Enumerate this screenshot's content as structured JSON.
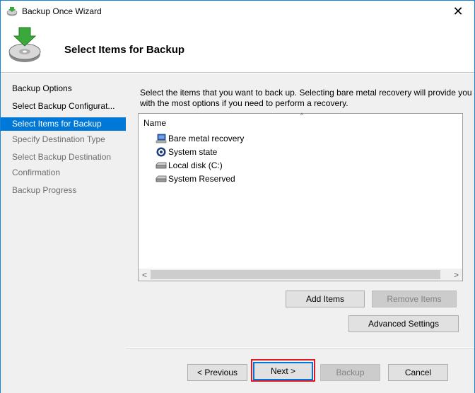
{
  "window": {
    "title": "Backup Once Wizard",
    "close_symbol": "✕",
    "app_icon": "backup-app-icon"
  },
  "header": {
    "title": "Select Items for Backup",
    "icon": "backup-disk-icon"
  },
  "nav": {
    "items": [
      {
        "label": "Backup Options",
        "state": "normal"
      },
      {
        "label": "Select Backup Configurat...",
        "state": "normal"
      },
      {
        "label": "Select Items for Backup",
        "state": "selected"
      },
      {
        "label": "Specify Destination Type",
        "state": "dim"
      },
      {
        "label": "Select Backup Destination",
        "state": "dim"
      },
      {
        "label": "Confirmation",
        "state": "dim"
      },
      {
        "label": "Backup Progress",
        "state": "dim"
      }
    ]
  },
  "content": {
    "instruction": "Select the items that you want to back up. Selecting bare metal recovery will provide you with the most options if you need to perform a recovery.",
    "list": {
      "column_name": "Name",
      "sort_caret": "^",
      "items": [
        {
          "label": "Bare metal recovery",
          "icon": "bare-metal-recovery-icon"
        },
        {
          "label": "System state",
          "icon": "system-state-icon"
        },
        {
          "label": "Local disk (C:)",
          "icon": "drive-icon"
        },
        {
          "label": "System Reserved",
          "icon": "drive-icon"
        }
      ],
      "scroll_left": "<",
      "scroll_right": ">"
    },
    "add_items": "Add Items",
    "remove_items": "Remove Items",
    "advanced_settings": "Advanced Settings"
  },
  "footer": {
    "previous": "< Previous",
    "next": "Next >",
    "backup": "Backup",
    "cancel": "Cancel"
  },
  "colors": {
    "accent": "#0078d7",
    "highlight_box": "#e0181f"
  }
}
